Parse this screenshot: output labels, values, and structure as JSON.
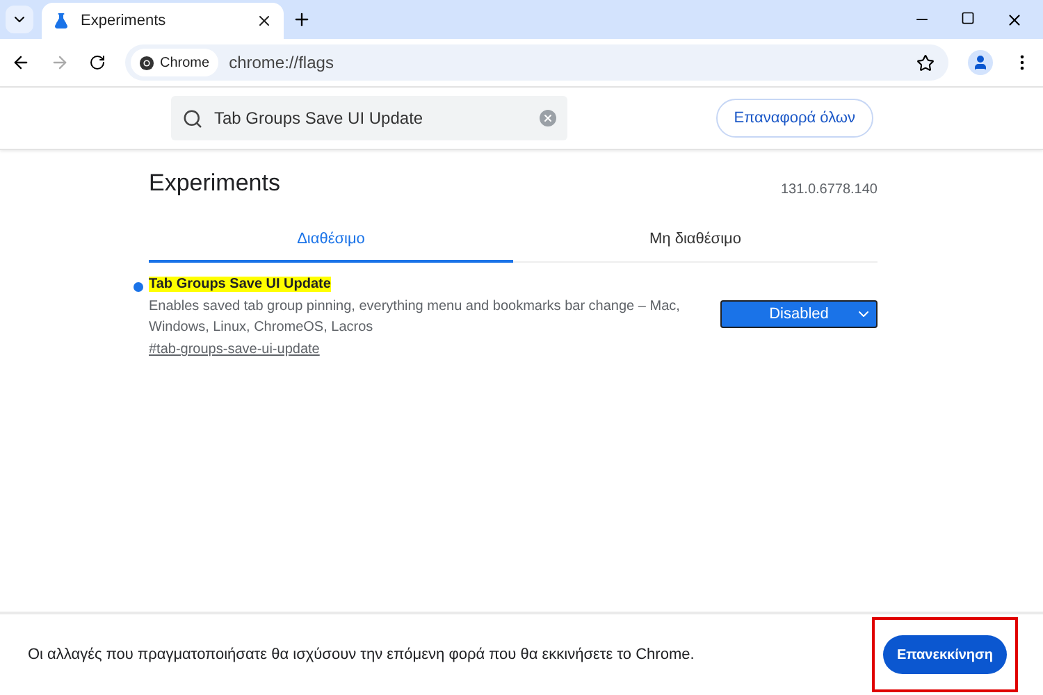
{
  "browser": {
    "tabs": [
      {
        "title": "Experiments",
        "selected": true
      }
    ],
    "address_chip": "Chrome",
    "url": "chrome://flags"
  },
  "search": {
    "value": "Tab Groups Save UI Update"
  },
  "reset_button": "Επαναφορά όλων",
  "page": {
    "title": "Experiments",
    "version": "131.0.6778.140"
  },
  "tabs": [
    {
      "label": "Διαθέσιμο",
      "selected": true
    },
    {
      "label": "Μη διαθέσιμο",
      "selected": false
    }
  ],
  "flags": [
    {
      "name": "Tab Groups Save UI Update",
      "highlighted": true,
      "description": "Enables saved tab group pinning, everything menu and bookmarks bar change – Mac, Windows, Linux, ChromeOS, Lacros",
      "link": "#tab-groups-save-ui-update",
      "value": "Disabled"
    }
  ],
  "footer": {
    "message": "Οι αλλαγές που πραγματοποιήσατε θα ισχύσουν την επόμενη φορά που θα εκκινήσετε το Chrome.",
    "button": "Επανεκκίνηση",
    "button_highlighted": true
  }
}
